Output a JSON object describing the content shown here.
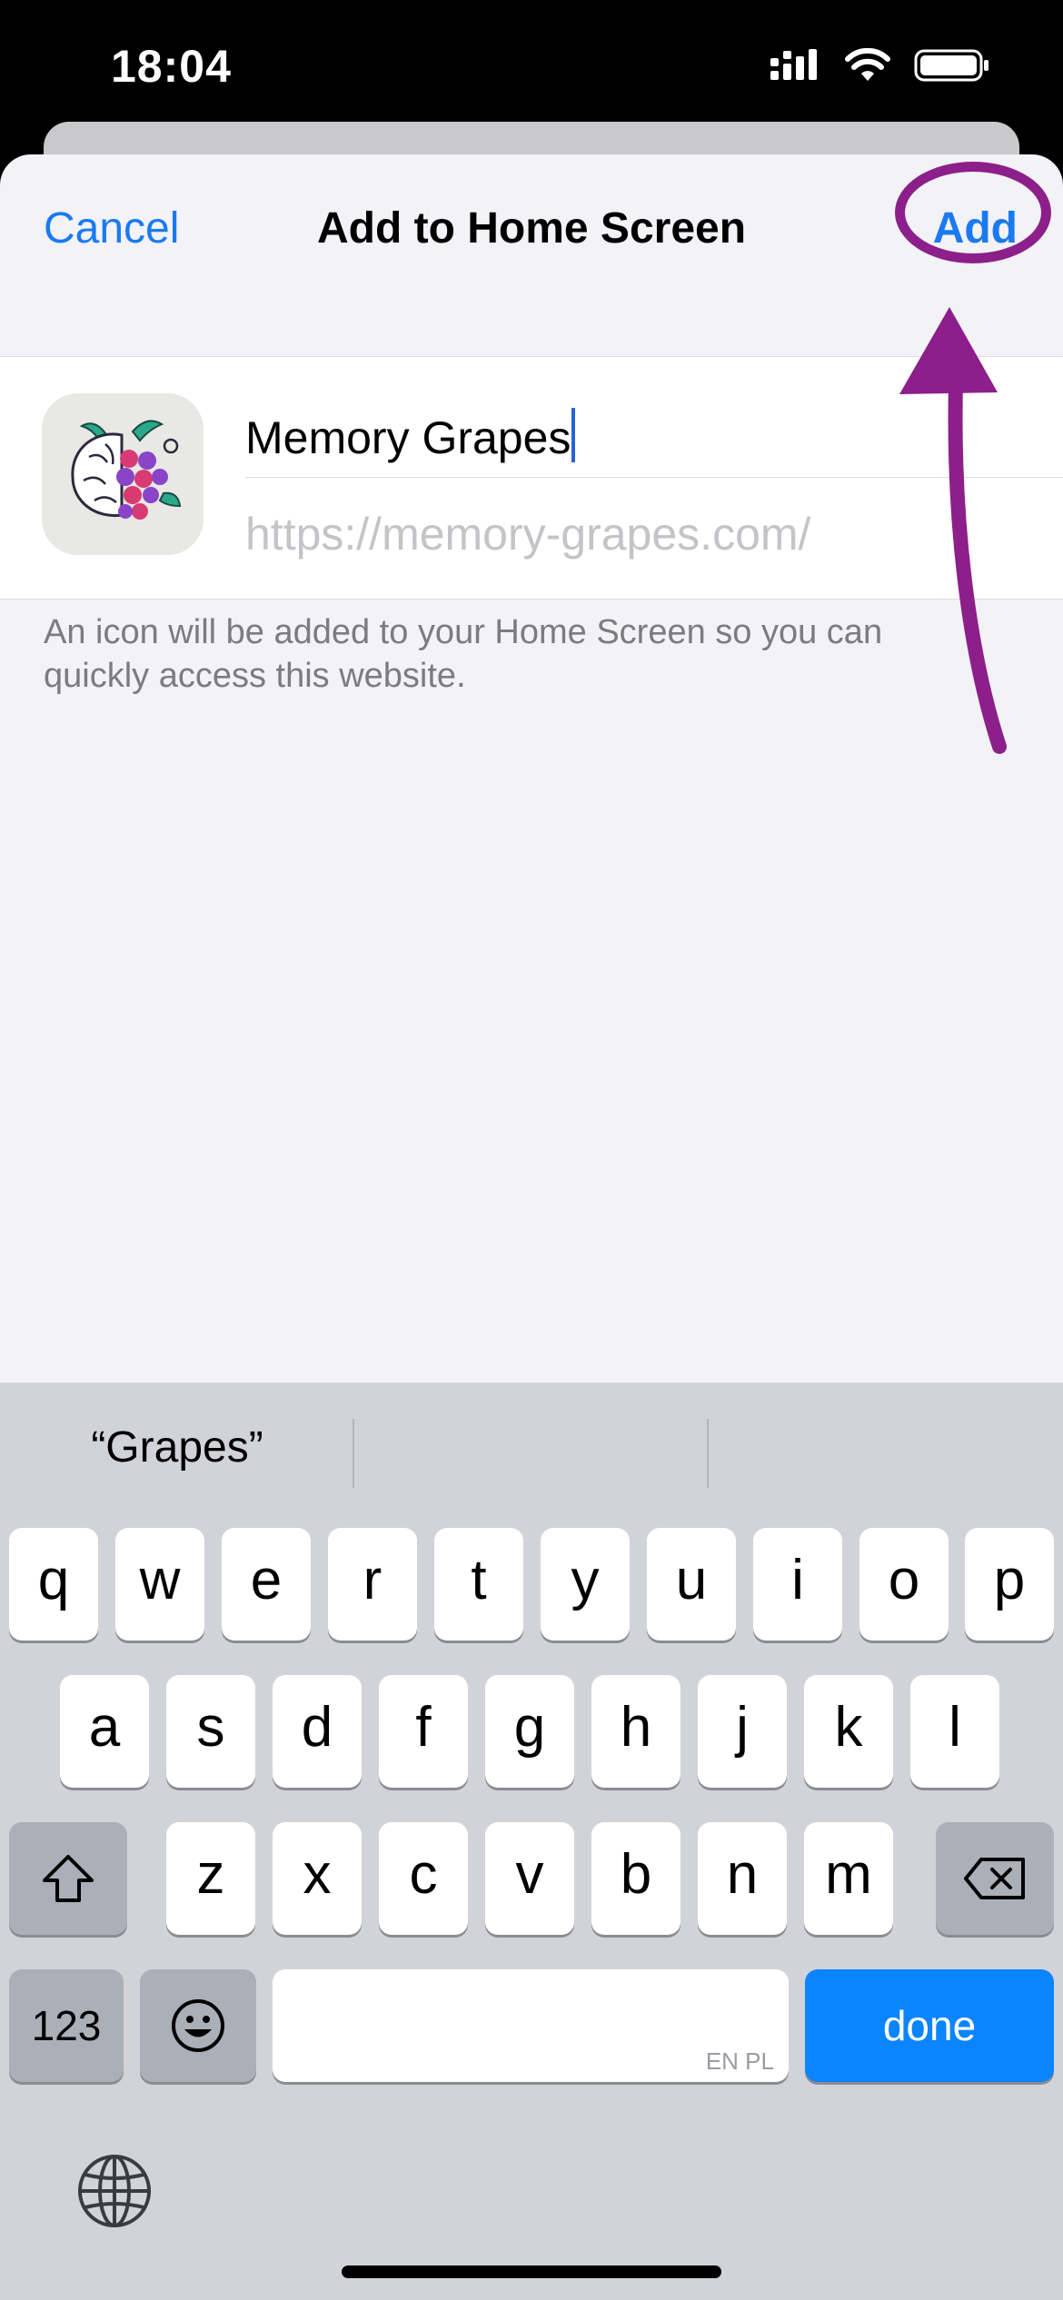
{
  "status": {
    "time": "18:04"
  },
  "nav": {
    "cancel": "Cancel",
    "title": "Add to Home Screen",
    "add": "Add"
  },
  "form": {
    "name_value": "Memory Grapes",
    "url_placeholder": "https://memory-grapes.com/",
    "helper": "An icon will be added to your Home Screen so you can quickly access this website."
  },
  "keyboard": {
    "suggestion": "“Grapes”",
    "row1": [
      "q",
      "w",
      "e",
      "r",
      "t",
      "y",
      "u",
      "i",
      "o",
      "p"
    ],
    "row2": [
      "a",
      "s",
      "d",
      "f",
      "g",
      "h",
      "j",
      "k",
      "l"
    ],
    "row3": [
      "z",
      "x",
      "c",
      "v",
      "b",
      "n",
      "m"
    ],
    "numbers_label": "123",
    "space_tag": "EN PL",
    "done_label": "done"
  },
  "colors": {
    "accent": "#1a7af0",
    "annotation": "#8c1f8a",
    "done_key": "#0a84ff"
  }
}
